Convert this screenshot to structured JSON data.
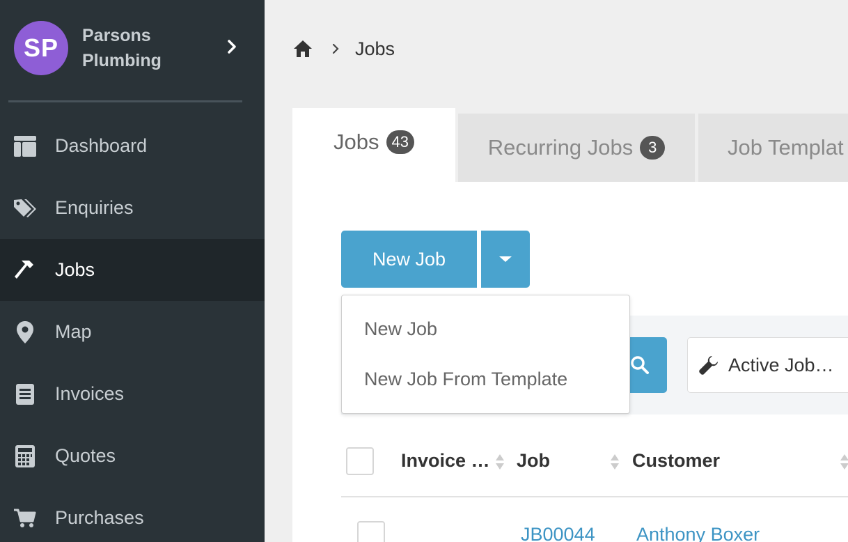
{
  "account": {
    "initials": "SP",
    "name": "Parsons Plumbing"
  },
  "nav": {
    "items": [
      {
        "label": "Dashboard",
        "icon": "dashboard-icon"
      },
      {
        "label": "Enquiries",
        "icon": "tags-icon"
      },
      {
        "label": "Jobs",
        "icon": "hammer-icon",
        "active": true
      },
      {
        "label": "Map",
        "icon": "map-pin-icon"
      },
      {
        "label": "Invoices",
        "icon": "invoice-icon"
      },
      {
        "label": "Quotes",
        "icon": "calculator-icon"
      },
      {
        "label": "Purchases",
        "icon": "cart-icon"
      }
    ]
  },
  "breadcrumb": {
    "current": "Jobs"
  },
  "tabs": [
    {
      "label": "Jobs",
      "count": "43",
      "active": true
    },
    {
      "label": "Recurring Jobs",
      "count": "3"
    },
    {
      "label": "Job Templat"
    }
  ],
  "toolbar": {
    "new_job_label": "New Job"
  },
  "dropdown": {
    "items": [
      "New Job",
      "New Job From Template"
    ]
  },
  "filter": {
    "status_label": "Active Job…"
  },
  "table": {
    "headers": [
      "Invoice …",
      "Job",
      "Customer"
    ],
    "rows": [
      {
        "job": "JB00044",
        "customer": "Anthony Boxer"
      }
    ]
  },
  "colors": {
    "sidebar": "#2a3338",
    "accent": "#4aa3ce",
    "avatar": "#8e5ed6",
    "link": "#3d94c4"
  }
}
